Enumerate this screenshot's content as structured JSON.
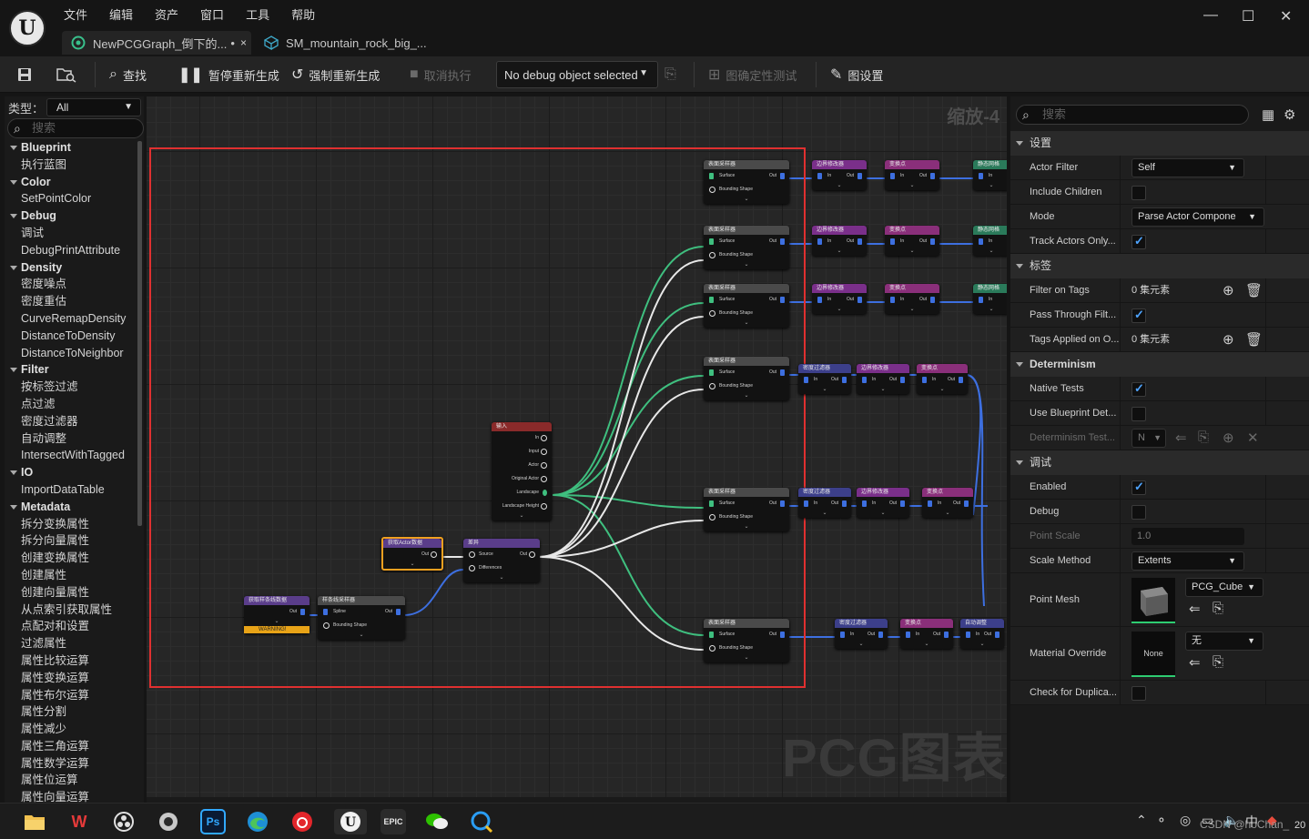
{
  "menu": [
    "文件",
    "编辑",
    "资产",
    "窗口",
    "工具",
    "帮助"
  ],
  "tabs": [
    {
      "label": "NewPCGGraph_倒下的...",
      "modified": "•",
      "close": "×"
    },
    {
      "label": "SM_mountain_rock_big_..."
    }
  ],
  "window": {
    "minimize": "—",
    "maximize": "☐",
    "close": "✕"
  },
  "toolbar": {
    "find": "查找",
    "pause_regen": "暂停重新生成",
    "force_regen": "强制重新生成",
    "cancel_exec": "取消执行",
    "debug_object": "No debug object selected",
    "determinism_test": "图确定性测试",
    "graph_settings": "图设置"
  },
  "palette": {
    "type_label": "类型：",
    "type_value": "All",
    "search_placeholder": "搜索",
    "items": [
      {
        "type": "cat",
        "label": "Blueprint"
      },
      {
        "type": "leaf",
        "label": "执行蓝图"
      },
      {
        "type": "cat",
        "label": "Color"
      },
      {
        "type": "leaf",
        "label": "SetPointColor"
      },
      {
        "type": "cat",
        "label": "Debug"
      },
      {
        "type": "leaf",
        "label": "调试"
      },
      {
        "type": "leaf",
        "label": "DebugPrintAttribute"
      },
      {
        "type": "cat",
        "label": "Density"
      },
      {
        "type": "leaf",
        "label": "密度噪点"
      },
      {
        "type": "leaf",
        "label": "密度重估"
      },
      {
        "type": "leaf",
        "label": "CurveRemapDensity"
      },
      {
        "type": "leaf",
        "label": "DistanceToDensity"
      },
      {
        "type": "leaf",
        "label": "DistanceToNeighbor"
      },
      {
        "type": "cat",
        "label": "Filter"
      },
      {
        "type": "leaf",
        "label": "按标签过滤"
      },
      {
        "type": "leaf",
        "label": "点过滤"
      },
      {
        "type": "leaf",
        "label": "密度过滤器"
      },
      {
        "type": "leaf",
        "label": "自动调整"
      },
      {
        "type": "leaf",
        "label": "IntersectWithTagged"
      },
      {
        "type": "cat",
        "label": "IO"
      },
      {
        "type": "leaf",
        "label": "ImportDataTable"
      },
      {
        "type": "cat",
        "label": "Metadata"
      },
      {
        "type": "leaf",
        "label": "拆分变换属性"
      },
      {
        "type": "leaf",
        "label": "拆分向量属性"
      },
      {
        "type": "leaf",
        "label": "创建变换属性"
      },
      {
        "type": "leaf",
        "label": "创建属性"
      },
      {
        "type": "leaf",
        "label": "创建向量属性"
      },
      {
        "type": "leaf",
        "label": "从点索引获取属性"
      },
      {
        "type": "leaf",
        "label": "点配对和设置"
      },
      {
        "type": "leaf",
        "label": "过滤属性"
      },
      {
        "type": "leaf",
        "label": "属性比较运算"
      },
      {
        "type": "leaf",
        "label": "属性变换运算"
      },
      {
        "type": "leaf",
        "label": "属性布尔运算"
      },
      {
        "type": "leaf",
        "label": "属性分割"
      },
      {
        "type": "leaf",
        "label": "属性减少"
      },
      {
        "type": "leaf",
        "label": "属性三角运算"
      },
      {
        "type": "leaf",
        "label": "属性数学运算"
      },
      {
        "type": "leaf",
        "label": "属性位运算"
      },
      {
        "type": "leaf",
        "label": "属性向量运算"
      }
    ]
  },
  "graph": {
    "zoom": "缩放-4",
    "watermark": "PCG图表",
    "nodes": {
      "sampler_title": "表面采样器",
      "boundary_mod": "边界修改器",
      "transform_pts": "变换点",
      "static_spawner": "静态网格",
      "density_filter": "密度过滤器",
      "self_prune": "自动调整",
      "input_title": "输入",
      "get_actor": "获取Actor数据",
      "diff": "差异",
      "get_spline": "获取样条线数据",
      "spline_sampler": "样条线采样器",
      "warning": "WARNING!",
      "pin_surface": "Surface",
      "pin_bounding": "Bounding Shape",
      "pin_out": "Out",
      "pin_in": "In",
      "pin_input": "Input",
      "pin_actor": "Actor",
      "pin_original_actor": "Original Actor",
      "pin_landscape": "Landscape",
      "pin_landscape_height": "Landscape Height",
      "pin_source": "Source",
      "pin_differences": "Differences",
      "pin_spline": "Spline"
    }
  },
  "details": {
    "search_placeholder": "搜索",
    "sections": {
      "settings": "设置",
      "tags": "标签",
      "determinism": "Determinism",
      "debug": "调试"
    },
    "props": {
      "actor_filter": {
        "label": "Actor Filter",
        "value": "Self"
      },
      "include_children": {
        "label": "Include Children",
        "checked": false
      },
      "mode": {
        "label": "Mode",
        "value": "Parse Actor Compone"
      },
      "track_actors": {
        "label": "Track Actors Only...",
        "checked": true
      },
      "filter_on_tags": {
        "label": "Filter on Tags",
        "value": "0 集元素"
      },
      "pass_through": {
        "label": "Pass Through Filt...",
        "checked": true
      },
      "tags_applied": {
        "label": "Tags Applied on O...",
        "value": "0 集元素"
      },
      "native_tests": {
        "label": "Native Tests",
        "checked": true
      },
      "use_blueprint_det": {
        "label": "Use Blueprint Det...",
        "checked": false
      },
      "determinism_test": {
        "label": "Determinism Test...",
        "value": "N"
      },
      "enabled": {
        "label": "Enabled",
        "checked": true
      },
      "debug": {
        "label": "Debug",
        "checked": false
      },
      "point_scale": {
        "label": "Point Scale",
        "value": "1.0"
      },
      "scale_method": {
        "label": "Scale Method",
        "value": "Extents"
      },
      "point_mesh": {
        "label": "Point Mesh",
        "value": "PCG_Cube"
      },
      "material_override": {
        "label": "Material Override",
        "value": "无",
        "thumb": "None"
      },
      "check_dup": {
        "label": "Check for Duplica...",
        "checked": false
      }
    }
  },
  "taskbar": {
    "apps": [
      "file-explorer",
      "wps",
      "obs",
      "camera",
      "photoshop",
      "edge",
      "netease-music",
      "unreal",
      "epic-games",
      "wechat",
      "qq-browser"
    ],
    "ps_label": "Ps",
    "epic_label": "EPIC",
    "csdn": "CSDN @hoChan_",
    "clock_frag": "20",
    "ime": "中"
  },
  "colors": {
    "accent_blue": "#4ea4ff",
    "selection_red": "#e03030",
    "pin_blue": "#3d6fe0",
    "wire_green": "#3fbf7f",
    "ok_green": "#2ecc71"
  }
}
